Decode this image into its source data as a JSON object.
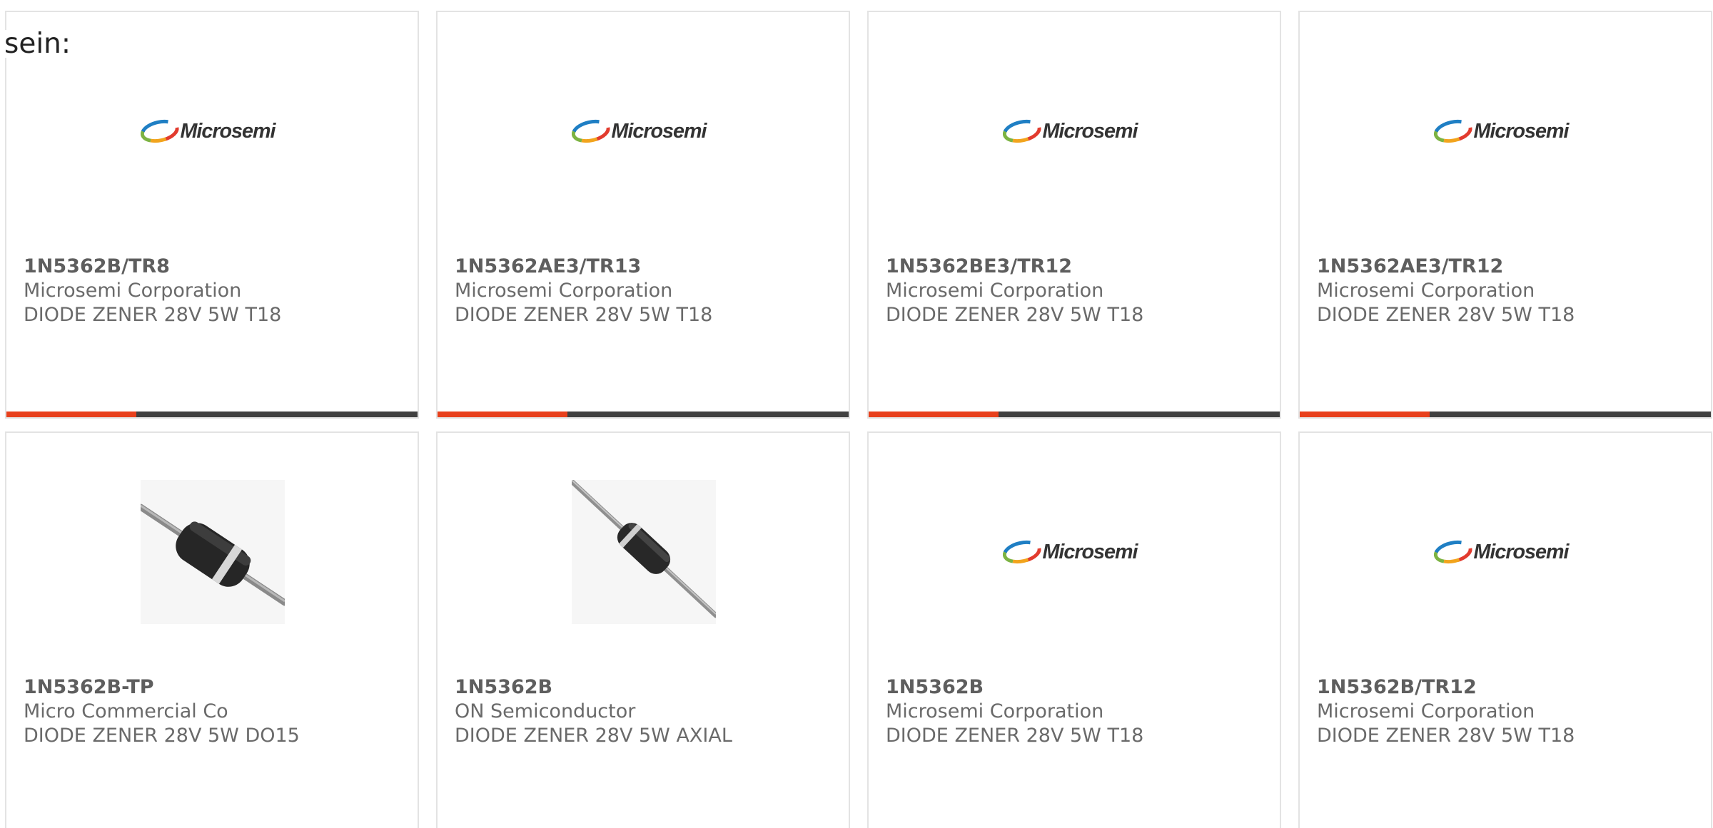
{
  "intro": {
    "text": "sein:"
  },
  "colors": {
    "accent_bar": "#e8401c",
    "bar_dark": "#404040",
    "card_border": "#e3e3e3",
    "text_dark": "#5e5e5e",
    "text_light": "#6a6a6a"
  },
  "cards": [
    {
      "part_number": "1N5362B/TR8",
      "manufacturer": "Microsemi Corporation",
      "description": "DIODE ZENER 28V 5W T18",
      "image": "microsemi-logo",
      "logo_text": "Microsemi"
    },
    {
      "part_number": "1N5362AE3/TR13",
      "manufacturer": "Microsemi Corporation",
      "description": "DIODE ZENER 28V 5W T18",
      "image": "microsemi-logo",
      "logo_text": "Microsemi"
    },
    {
      "part_number": "1N5362BE3/TR12",
      "manufacturer": "Microsemi Corporation",
      "description": "DIODE ZENER 28V 5W T18",
      "image": "microsemi-logo",
      "logo_text": "Microsemi"
    },
    {
      "part_number": "1N5362AE3/TR12",
      "manufacturer": "Microsemi Corporation",
      "description": "DIODE ZENER 28V 5W T18",
      "image": "microsemi-logo",
      "logo_text": "Microsemi"
    },
    {
      "part_number": "1N5362B-TP",
      "manufacturer": "Micro Commercial Co",
      "description": "DIODE ZENER 28V 5W DO15",
      "image": "diode-do15-photo"
    },
    {
      "part_number": "1N5362B",
      "manufacturer": "ON Semiconductor",
      "description": "DIODE ZENER 28V 5W AXIAL",
      "image": "diode-axial-photo"
    },
    {
      "part_number": "1N5362B",
      "manufacturer": "Microsemi Corporation",
      "description": "DIODE ZENER 28V 5W T18",
      "image": "microsemi-logo",
      "logo_text": "Microsemi"
    },
    {
      "part_number": "1N5362B/TR12",
      "manufacturer": "Microsemi Corporation",
      "description": "DIODE ZENER 28V 5W T18",
      "image": "microsemi-logo",
      "logo_text": "Microsemi"
    }
  ]
}
